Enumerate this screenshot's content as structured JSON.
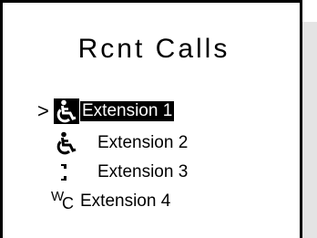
{
  "screen": {
    "title": "Rcnt Calls",
    "cursor": ">",
    "items": [
      {
        "label": "Extension 1",
        "icon": "wheelchair-icon",
        "selected": true
      },
      {
        "label": "Extension 2",
        "icon": "wheelchair-icon",
        "selected": false
      },
      {
        "label": "Extension 3",
        "icon": "phone-handset-icon",
        "selected": false
      },
      {
        "label": "Extension 4",
        "icon": "wc-icon",
        "icon_text_w": "W",
        "icon_text_c": "C",
        "selected": false
      }
    ]
  },
  "colors": {
    "border": "#000000",
    "selection_bg": "#000000",
    "selection_text": "#ffffff",
    "side_panel": "#e4e4e4"
  }
}
